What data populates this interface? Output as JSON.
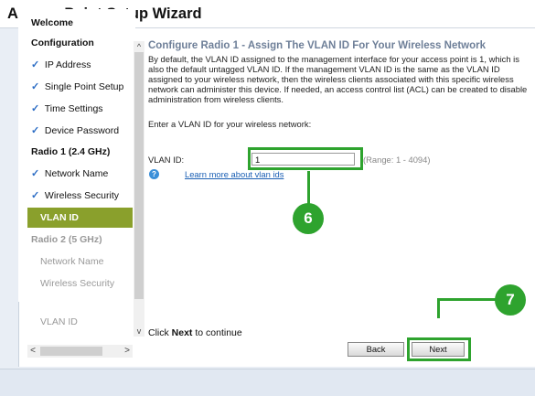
{
  "window": {
    "title": "Access Point Setup Wizard"
  },
  "sidebar": {
    "items": [
      {
        "label": "Welcome",
        "type": "section",
        "check": ""
      },
      {
        "label": "Configuration",
        "type": "section",
        "check": ""
      },
      {
        "label": "IP Address",
        "type": "sub",
        "check": "✓"
      },
      {
        "label": "Single Point Setup",
        "type": "sub",
        "check": "✓"
      },
      {
        "label": "Time Settings",
        "type": "sub",
        "check": "✓"
      },
      {
        "label": "Device Password",
        "type": "sub",
        "check": "✓"
      },
      {
        "label": "Radio 1 (2.4 GHz)",
        "type": "section",
        "check": ""
      },
      {
        "label": "Network Name",
        "type": "sub",
        "check": "✓"
      },
      {
        "label": "Wireless Security",
        "type": "sub",
        "check": "✓"
      },
      {
        "label": "VLAN ID",
        "type": "active",
        "check": ""
      },
      {
        "label": "Radio 2 (5 GHz)",
        "type": "disabled-section",
        "check": ""
      },
      {
        "label": "Network Name",
        "type": "disabled",
        "check": ""
      },
      {
        "label": "Wireless Security",
        "type": "disabled",
        "check": ""
      },
      {
        "label": "VLAN ID",
        "type": "disabled",
        "check": ""
      }
    ],
    "scroll_left": "<",
    "scroll_right": ">",
    "scroll_up": "^",
    "scroll_down": "v"
  },
  "main": {
    "heading": "Configure Radio 1 - Assign The VLAN ID For Your Wireless Network",
    "description": "By default, the VLAN ID assigned to the management interface for your access point is 1, which is also the default untagged VLAN ID. If the management VLAN ID is the same as the VLAN ID assigned to your wireless network, then the wireless clients associated with this specific wireless network can administer this device. If needed, an access control list (ACL) can be created to disable administration from wireless clients.",
    "prompt": "Enter a VLAN ID for your wireless network:",
    "vlan_label": "VLAN ID:",
    "vlan_value": "1",
    "range": "(Range: 1 - 4094)",
    "help_icon": "?",
    "learn_link": "Learn more about vlan ids"
  },
  "footer": {
    "click_prefix": "Click ",
    "click_bold": "Next",
    "click_suffix": " to continue",
    "back_label": "Back",
    "next_label": "Next"
  },
  "callouts": {
    "step_a": "6",
    "step_b": "7"
  },
  "colors": {
    "accent_green": "#2ea32e",
    "active_nav": "#8aa02c",
    "heading": "#6e7f98",
    "link": "#1a5fb4"
  }
}
